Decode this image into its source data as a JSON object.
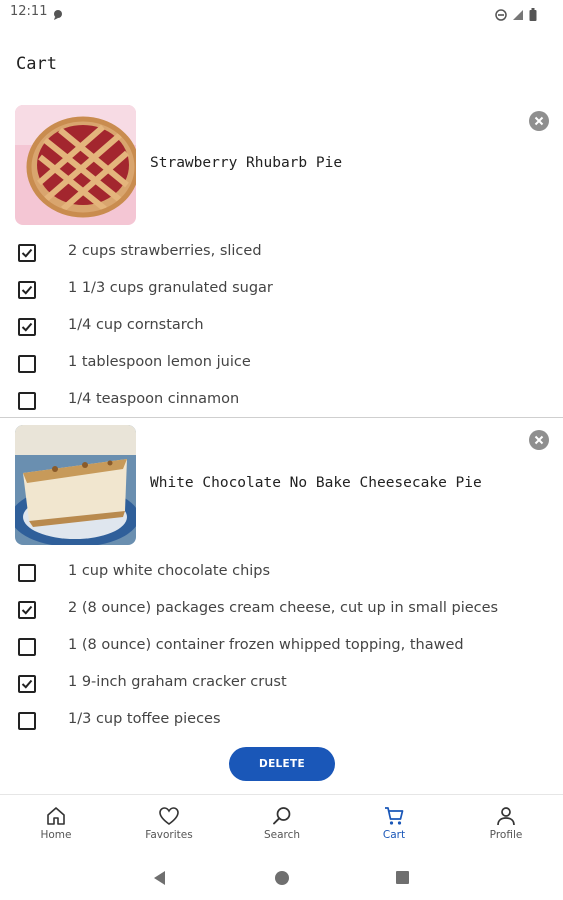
{
  "status": {
    "time": "12:11"
  },
  "page": {
    "title": "Cart"
  },
  "recipes": [
    {
      "title": "Strawberry Rhubarb Pie",
      "ingredients": [
        {
          "label": "2 cups strawberries, sliced",
          "checked": true
        },
        {
          "label": "1 1/3 cups granulated sugar",
          "checked": true
        },
        {
          "label": "1/4 cup cornstarch",
          "checked": true
        },
        {
          "label": "1 tablespoon lemon juice",
          "checked": false
        },
        {
          "label": "1/4 teaspoon cinnamon",
          "checked": false
        }
      ]
    },
    {
      "title": "White Chocolate No Bake Cheesecake Pie",
      "ingredients": [
        {
          "label": "1 cup white chocolate chips",
          "checked": false
        },
        {
          "label": "2 (8 ounce) packages cream cheese, cut up in small pieces",
          "checked": true
        },
        {
          "label": "1 (8 ounce) container frozen whipped topping, thawed",
          "checked": false
        },
        {
          "label": "1 9-inch graham cracker crust",
          "checked": true
        },
        {
          "label": "1/3 cup toffee pieces",
          "checked": false
        }
      ]
    }
  ],
  "actions": {
    "delete_label": "DELETE"
  },
  "nav": {
    "items": [
      {
        "label": "Home",
        "icon": "home-icon"
      },
      {
        "label": "Favorites",
        "icon": "heart-icon"
      },
      {
        "label": "Search",
        "icon": "search-icon"
      },
      {
        "label": "Cart",
        "icon": "cart-icon"
      },
      {
        "label": "Profile",
        "icon": "person-icon"
      }
    ],
    "active": "Cart"
  },
  "colors": {
    "accent": "#1a57b8",
    "remove": "#8f8f8f"
  }
}
